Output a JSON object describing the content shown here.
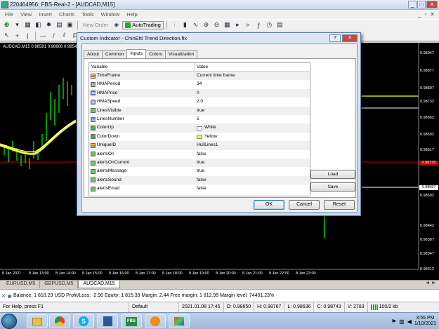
{
  "window": {
    "title": "220464956: FBS-Real-2 - [AUDCAD,M15]",
    "min": "_",
    "max": "□",
    "close": "✕"
  },
  "menu": {
    "items": [
      "File",
      "View",
      "Insert",
      "Charts",
      "Tools",
      "Window",
      "Help"
    ]
  },
  "toolbar": {
    "new_order": "New Order",
    "autotrading": "AutoTrading"
  },
  "chart": {
    "symbol_info": "AUDCAD,M15  0.98581 0.98606 0.98542 0.98561",
    "price_ticks": [
      "0.98947",
      "0.98877",
      "0.98807",
      "0.98732",
      "0.98662",
      "0.98592",
      "0.98517",
      "0.98502",
      "0.98442",
      "0.98387",
      "0.98347",
      "0.98312"
    ],
    "price_box_red": "0.98730",
    "price_box_white": "0.98587",
    "time_ticks": [
      "8 Jan 2021",
      "8 Jan 13:00",
      "8 Jan 14:00",
      "8 Jan 15:00",
      "8 Jan 16:00",
      "8 Jan 17:00",
      "8 Jan 18:00",
      "8 Jan 19:00",
      "8 Jan 20:00",
      "8 Jan 21:00",
      "8 Jan 22:00",
      "8 Jan 23:00"
    ]
  },
  "dialog": {
    "title": "Custom Indicator - ChinEtti Trend Direction.fix",
    "help": "?",
    "close": "✕",
    "tabs": [
      "About",
      "Common",
      "Inputs",
      "Colors",
      "Visualization"
    ],
    "active_tab": "Inputs",
    "headers": {
      "variable": "Variable",
      "value": "Value"
    },
    "params": [
      {
        "icon": "ab",
        "variable": "TimeFrame",
        "value": "Current time frame"
      },
      {
        "icon": "num",
        "variable": "HMAPeriod",
        "value": "34"
      },
      {
        "icon": "num",
        "variable": "HMAPrice",
        "value": "0"
      },
      {
        "icon": "dbl",
        "variable": "HMASpeed",
        "value": "2.0"
      },
      {
        "icon": "bool",
        "variable": "LinesVisible",
        "value": "true"
      },
      {
        "icon": "num",
        "variable": "LinesNumber",
        "value": "5"
      },
      {
        "icon": "clr",
        "variable": "ColorUp",
        "value": "White",
        "swatch": "#ffffff"
      },
      {
        "icon": "clr",
        "variable": "ColorDown",
        "value": "Yellow",
        "swatch": "#ffff00"
      },
      {
        "icon": "ab",
        "variable": "UniqueID",
        "value": "HullLines1"
      },
      {
        "icon": "bool",
        "variable": "alertsOn",
        "value": "false"
      },
      {
        "icon": "bool",
        "variable": "alertsOnCurrent",
        "value": "true"
      },
      {
        "icon": "bool",
        "variable": "alertsMessage",
        "value": "true"
      },
      {
        "icon": "bool",
        "variable": "alertsSound",
        "value": "false"
      },
      {
        "icon": "bool",
        "variable": "alertsEmail",
        "value": "false"
      }
    ],
    "load": "Load",
    "save": "Save",
    "ok": "OK",
    "cancel": "Cancel",
    "reset": "Reset"
  },
  "chart_tabs": {
    "items": [
      "EURUSD,M5",
      "GBPUSD,M5",
      "AUDCAD,M15"
    ],
    "active": "AUDCAD,M15",
    "nav": "◄ ►"
  },
  "terminal": {
    "balance_line": "Balance: 1 818.29 USD  Profit/Loss: -2.90  Equity: 1 815.39  Margin: 2.44  Free margin: 1 812.95  Margin level: 74401.23%"
  },
  "status": {
    "help": "For Help, press F1",
    "profile": "Default",
    "datetime": "2021.01.08 17:45",
    "open": "O: 0.98650",
    "high": "H: 0.98767",
    "low": "L: 0.98636",
    "close": "C: 0.98743",
    "volume": "V: 2783",
    "traffic": "100/2 kb"
  },
  "taskbar": {
    "time": "3:55 PM",
    "date": "1/10/2021",
    "fbs_label": "FBS"
  },
  "colors": {
    "accent": "#3c7fb1",
    "bull": "#00c800",
    "redline": "#c00000",
    "yellowline": "#ffff00"
  }
}
